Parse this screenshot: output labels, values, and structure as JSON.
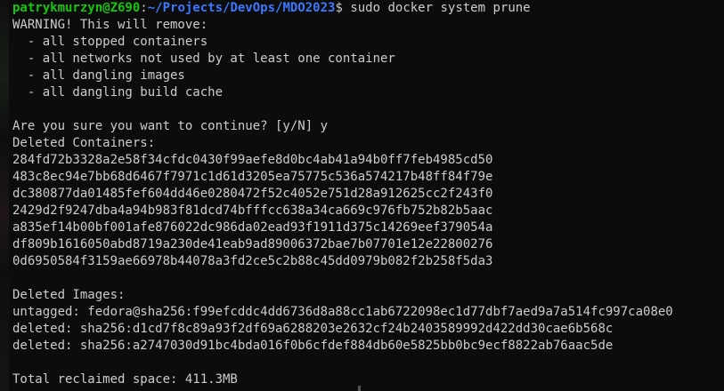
{
  "prompt": {
    "user_host": "patrykmurzyn@Z690",
    "separator": ":",
    "path": "~/Projects/DevOps/MDO2023",
    "dollar": "$",
    "command": " sudo docker system prune"
  },
  "warning": {
    "header": "WARNING! This will remove:",
    "items": [
      "  - all stopped containers",
      "  - all networks not used by at least one container",
      "  - all dangling images",
      "  - all dangling build cache"
    ]
  },
  "confirm": "Are you sure you want to continue? [y/N] y",
  "containers": {
    "header": "Deleted Containers:",
    "ids": [
      "284fd72b3328a2e58f34cfdc0430f99aefe8d0bc4ab41a94b0ff7feb4985cd50",
      "483c8ec94e7bb68d6467f7971c1d61d3205ea75775c536a574217b48ff84f79e",
      "dc380877da01485fef604dd46e0280472f52c4052e751d28a912625cc2f243f0",
      "2429d2f9247dba4a94b983f81dcd74bfffcc638a34ca669c976fb752b82b5aac",
      "a835ef14b00bf001afe876022dc986da02ead93f1911d375c14269eef379054a",
      "df809b1616050abd8719a230de41eab9ad89006372bae7b07701e12e22800276",
      "0d6950584f3159ae66978b44078a3fd2ce5c2b88c45dd0979b082f2b258f5da3"
    ]
  },
  "images": {
    "header": "Deleted Images:",
    "entries": [
      "untagged: fedora@sha256:f99efcddc4dd6736d8a88cc1ab6722098ec1d77dbf7aed9a7a514fc997ca08e0",
      "deleted: sha256:d1cd7f8c89a93f2df69a6288203e2632cf24b2403589992d422dd30cae6b568c",
      "deleted: sha256:a2747030d91bc4bda016f0b6cfdef884db60e5825bb0bc9ecf8822ab76aac5de"
    ]
  },
  "total": "Total reclaimed space: 411.3MB",
  "colors": {
    "background": "#0c0c0c",
    "text": "#cccccc",
    "user_host": "#16c60c",
    "path": "#3b78ff"
  }
}
